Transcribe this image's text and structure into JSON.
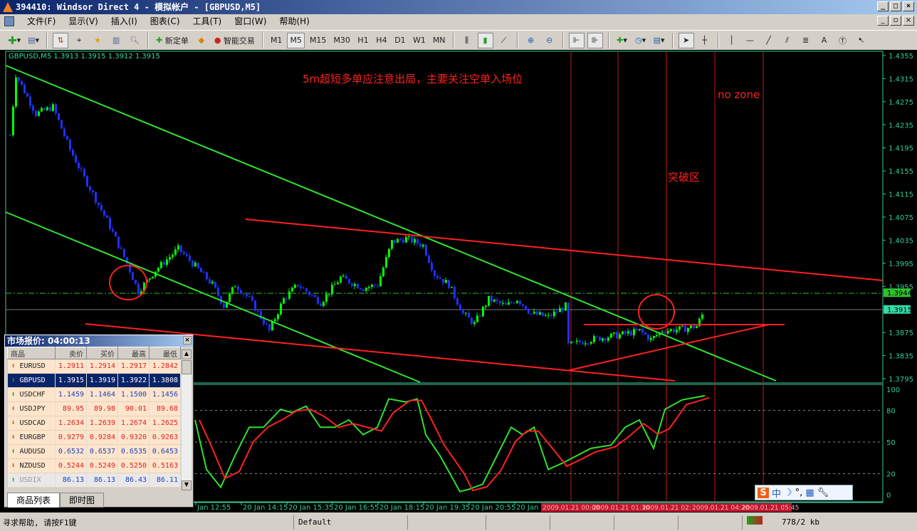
{
  "window": {
    "title": "394410: Windsor Direct 4 - 模拟帐户 - [GBPUSD,M5]"
  },
  "menu": [
    "文件(F)",
    "显示(V)",
    "插入(I)",
    "图表(C)",
    "工具(T)",
    "窗口(W)",
    "帮助(H)"
  ],
  "toolbar": {
    "new_order": "新定单",
    "expert": "智能交易",
    "timeframes": [
      "M1",
      "M5",
      "M15",
      "M30",
      "H1",
      "H4",
      "D1",
      "W1",
      "MN"
    ],
    "active_timeframe": "M5",
    "text_tool": "A"
  },
  "chart": {
    "header": "GBPUSD,M5  1.3913 1.3915 1.3912 1.3915",
    "annotations": {
      "main": "5m超短多单应注意出局，主要关注空单入场位",
      "no_zone": "no zone",
      "breakout": "突破区"
    },
    "price_ticks": [
      "1.4355",
      "1.4315",
      "1.4275",
      "1.4235",
      "1.4195",
      "1.4155",
      "1.4115",
      "1.4075",
      "1.4035",
      "1.3995",
      "1.3955",
      "1.3875",
      "1.3835",
      "1.3795"
    ],
    "price_labels": {
      "level": "1.3944",
      "bid": "1.3915"
    },
    "indicator_ticks": [
      "100",
      "80",
      "50",
      "20",
      "0"
    ],
    "time_labels": [
      "Jan 12:55",
      "20 Jan 14:15",
      "20 Jan 15:35",
      "20 Jan 16:55",
      "20 Jan 18:15",
      "20 Jan 19:35",
      "20 Jan 20:55",
      "20 Jan 22:15"
    ],
    "red_time_labels": [
      "2009.01.21 00:00",
      "2009.01.21 01:30",
      "2009.01.21 02:",
      "2009.01.21 04:20",
      "2009.01.21 05:45"
    ],
    "colors": {
      "up": "#00ff00",
      "down": "#2030ff",
      "axis": "#33cc99",
      "trend_red": "#ff2020",
      "trend_green": "#30e030"
    }
  },
  "chart_data": {
    "type": "candlestick",
    "symbol": "GBPUSD",
    "timeframe": "M5",
    "ylim": [
      1.3795,
      1.4355
    ],
    "close_path": [
      [
        1,
        1.4217
      ],
      [
        3,
        1.4322
      ],
      [
        10,
        1.4254
      ],
      [
        16,
        1.4266
      ],
      [
        22,
        1.4192
      ],
      [
        27,
        1.4143
      ],
      [
        35,
        1.4069
      ],
      [
        42,
        1.3995
      ],
      [
        46,
        1.3946
      ],
      [
        52,
        1.3983
      ],
      [
        60,
        1.402
      ],
      [
        65,
        1.3995
      ],
      [
        72,
        1.3958
      ],
      [
        76,
        1.3921
      ],
      [
        80,
        1.3958
      ],
      [
        85,
        1.3933
      ],
      [
        92,
        1.3878
      ],
      [
        97,
        1.3933
      ],
      [
        102,
        1.3958
      ],
      [
        110,
        1.3927
      ],
      [
        117,
        1.397
      ],
      [
        125,
        1.3952
      ],
      [
        130,
        1.3958
      ],
      [
        135,
        1.4032
      ],
      [
        140,
        1.4038
      ],
      [
        146,
        1.4026
      ],
      [
        150,
        1.3976
      ],
      [
        155,
        1.3958
      ],
      [
        160,
        1.3908
      ],
      [
        164,
        1.389
      ],
      [
        169,
        1.3933
      ],
      [
        175,
        1.3921
      ],
      [
        179,
        1.3933
      ],
      [
        184,
        1.3908
      ],
      [
        190,
        1.3902
      ],
      [
        196,
        1.3921
      ],
      [
        197,
        1.3853
      ],
      [
        205,
        1.3863
      ],
      [
        215,
        1.3871
      ],
      [
        222,
        1.3878
      ],
      [
        226,
        1.3863
      ],
      [
        230,
        1.3878
      ],
      [
        237,
        1.3881
      ],
      [
        242,
        1.3886
      ],
      [
        245,
        1.3915
      ]
    ],
    "indicator": {
      "name": "Stochastic",
      "ylim": [
        0,
        100
      ],
      "levels": [
        20,
        50,
        80
      ],
      "main": [
        [
          66,
          71
        ],
        [
          70,
          24
        ],
        [
          75,
          7
        ],
        [
          80,
          37
        ],
        [
          85,
          64
        ],
        [
          90,
          64
        ],
        [
          96,
          81
        ],
        [
          100,
          78
        ],
        [
          105,
          84
        ],
        [
          110,
          64
        ],
        [
          115,
          64
        ],
        [
          120,
          71
        ],
        [
          125,
          57
        ],
        [
          130,
          64
        ],
        [
          134,
          91
        ],
        [
          140,
          88
        ],
        [
          144,
          91
        ],
        [
          147,
          57
        ],
        [
          152,
          37
        ],
        [
          159,
          3
        ],
        [
          162,
          5
        ],
        [
          167,
          10
        ],
        [
          172,
          37
        ],
        [
          177,
          64
        ],
        [
          181,
          57
        ],
        [
          185,
          64
        ],
        [
          190,
          24
        ],
        [
          195,
          30
        ],
        [
          200,
          37
        ],
        [
          205,
          44
        ],
        [
          212,
          47
        ],
        [
          217,
          64
        ],
        [
          222,
          71
        ],
        [
          227,
          44
        ],
        [
          231,
          81
        ],
        [
          237,
          90
        ],
        [
          245,
          94
        ]
      ]
    }
  },
  "watch": {
    "title": "市场报价: 04:00:13",
    "headers": [
      "商品",
      "卖价",
      "买价",
      "最高",
      "最低"
    ],
    "rows": [
      {
        "sym": "EURUSD",
        "dir": "down",
        "v": [
          "1.2911",
          "1.2914",
          "1.2917",
          "1.2842"
        ]
      },
      {
        "sym": "GBPUSD",
        "dir": "up",
        "sel": true,
        "v": [
          "1.3915",
          "1.3919",
          "1.3922",
          "1.3808"
        ]
      },
      {
        "sym": "USDCHF",
        "dir": "up",
        "v": [
          "1.1459",
          "1.1464",
          "1.1500",
          "1.1456"
        ]
      },
      {
        "sym": "USDJPY",
        "dir": "down",
        "v": [
          "89.95",
          "89.98",
          "90.01",
          "89.68"
        ]
      },
      {
        "sym": "USDCAD",
        "dir": "down",
        "v": [
          "1.2634",
          "1.2639",
          "1.2674",
          "1.2625"
        ]
      },
      {
        "sym": "EURGBP",
        "dir": "down",
        "v": [
          "0.9279",
          "0.9284",
          "0.9320",
          "0.9263"
        ]
      },
      {
        "sym": "AUDUSD",
        "dir": "up",
        "v": [
          "0.6532",
          "0.6537",
          "0.6535",
          "0.6453"
        ]
      },
      {
        "sym": "NZDUSD",
        "dir": "down",
        "v": [
          "0.5244",
          "0.5249",
          "0.5250",
          "0.5163"
        ]
      },
      {
        "sym": "USDIX",
        "dir": "up",
        "dim": true,
        "v": [
          "86.13",
          "86.13",
          "86.43",
          "86.11"
        ]
      }
    ],
    "tabs": [
      "商品列表",
      "即时图"
    ]
  },
  "ime": {
    "label": "中"
  },
  "status": {
    "help": "寻求帮助, 请按F1键",
    "profile": "Default",
    "traffic": "778/2 kb"
  }
}
